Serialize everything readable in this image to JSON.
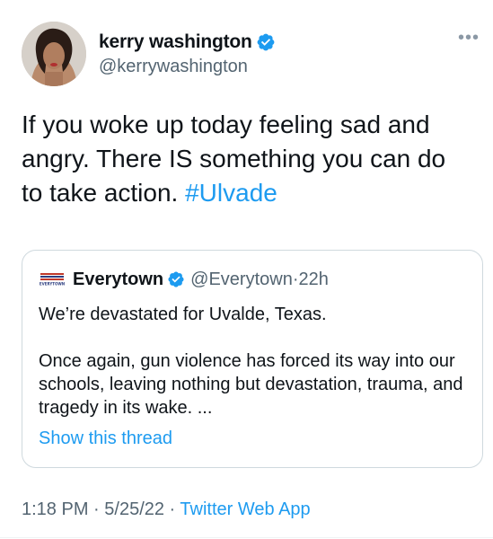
{
  "author": {
    "display_name": "kerry washington",
    "handle": "@kerrywashington",
    "verified": true
  },
  "more_icon": "more-options-icon",
  "tweet": {
    "text": "If you woke up today feeling sad and angry. There IS something you can do to take action. ",
    "hashtag": "#Ulvade"
  },
  "quoted_tweet": {
    "display_name": "Everytown",
    "handle": "@Everytown",
    "separator": "·",
    "time_ago": "22h",
    "paragraph_1": "We’re devastated for Uvalde, Texas.",
    "paragraph_2": "Once again, gun violence has forced its way into our schools, leaving nothing but devastation, trauma, and tragedy in its wake. ...",
    "show_thread": "Show this thread",
    "avatar_text": "EVERYTOWN"
  },
  "footer": {
    "time": "1:18 PM",
    "dot_1": " · ",
    "date": "5/25/22",
    "dot_2": " · ",
    "app": "Twitter Web App"
  },
  "colors": {
    "accent": "#1d9bf0",
    "text": "#0f1419",
    "secondary": "#536471",
    "border": "#cfd9de"
  }
}
